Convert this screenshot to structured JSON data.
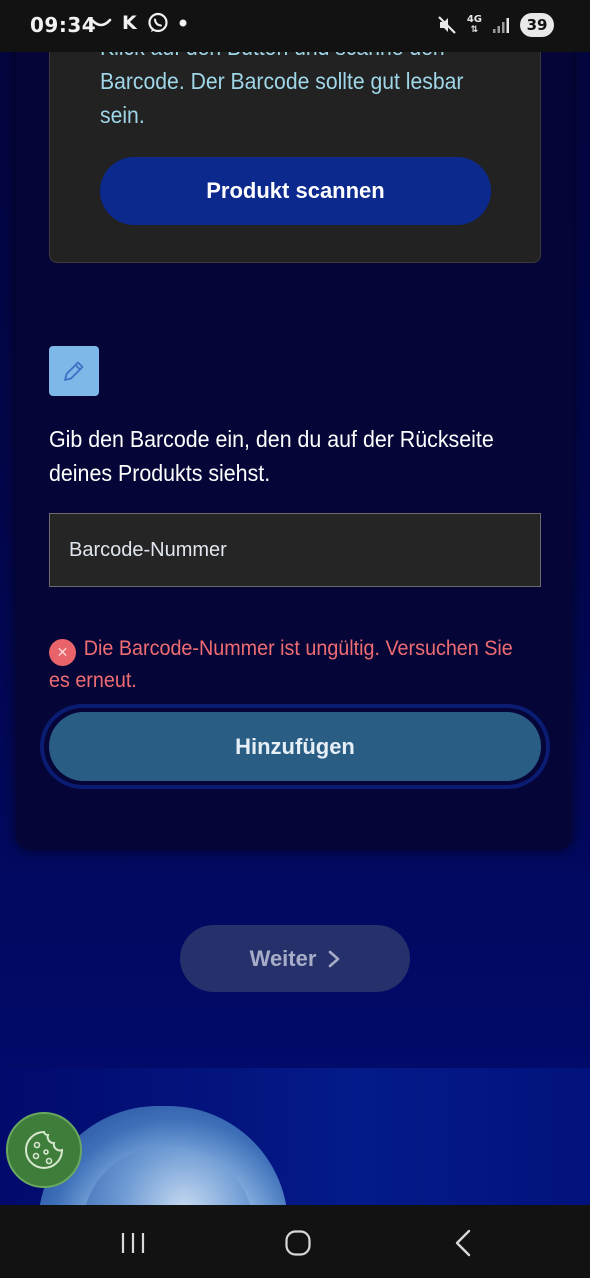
{
  "status_bar": {
    "time": "09:34",
    "left_letter": "K",
    "network_label": "4G",
    "battery": "39"
  },
  "scan_card": {
    "text": "Klick auf den Button und scanne den Barcode. Der Barcode sollte gut lesbar sein.",
    "button_label": "Produkt scannen"
  },
  "manual_entry": {
    "instruction": "Gib den Barcode ein, den du auf der Rückseite deines Produkts siehst.",
    "input_placeholder": "Barcode-Nummer",
    "input_value": "",
    "error_message": "Die Barcode-Nummer ist ungültig. Versuchen Sie es erneut.",
    "add_button_label": "Hinzufügen"
  },
  "navigation": {
    "next_label": "Weiter",
    "next_chevron": ">"
  },
  "icons": {
    "edit": "pencil-icon",
    "error": "error-x-icon",
    "cookie": "cookie-icon",
    "next": "chevron-right-icon"
  },
  "colors": {
    "primary_button": "#0c2a8e",
    "add_button": "#2a5d84",
    "error": "#ef6c72",
    "page_background": "#03064a",
    "edit_tile": "#7db8e8",
    "cookie_button": "#3f7d3b"
  }
}
